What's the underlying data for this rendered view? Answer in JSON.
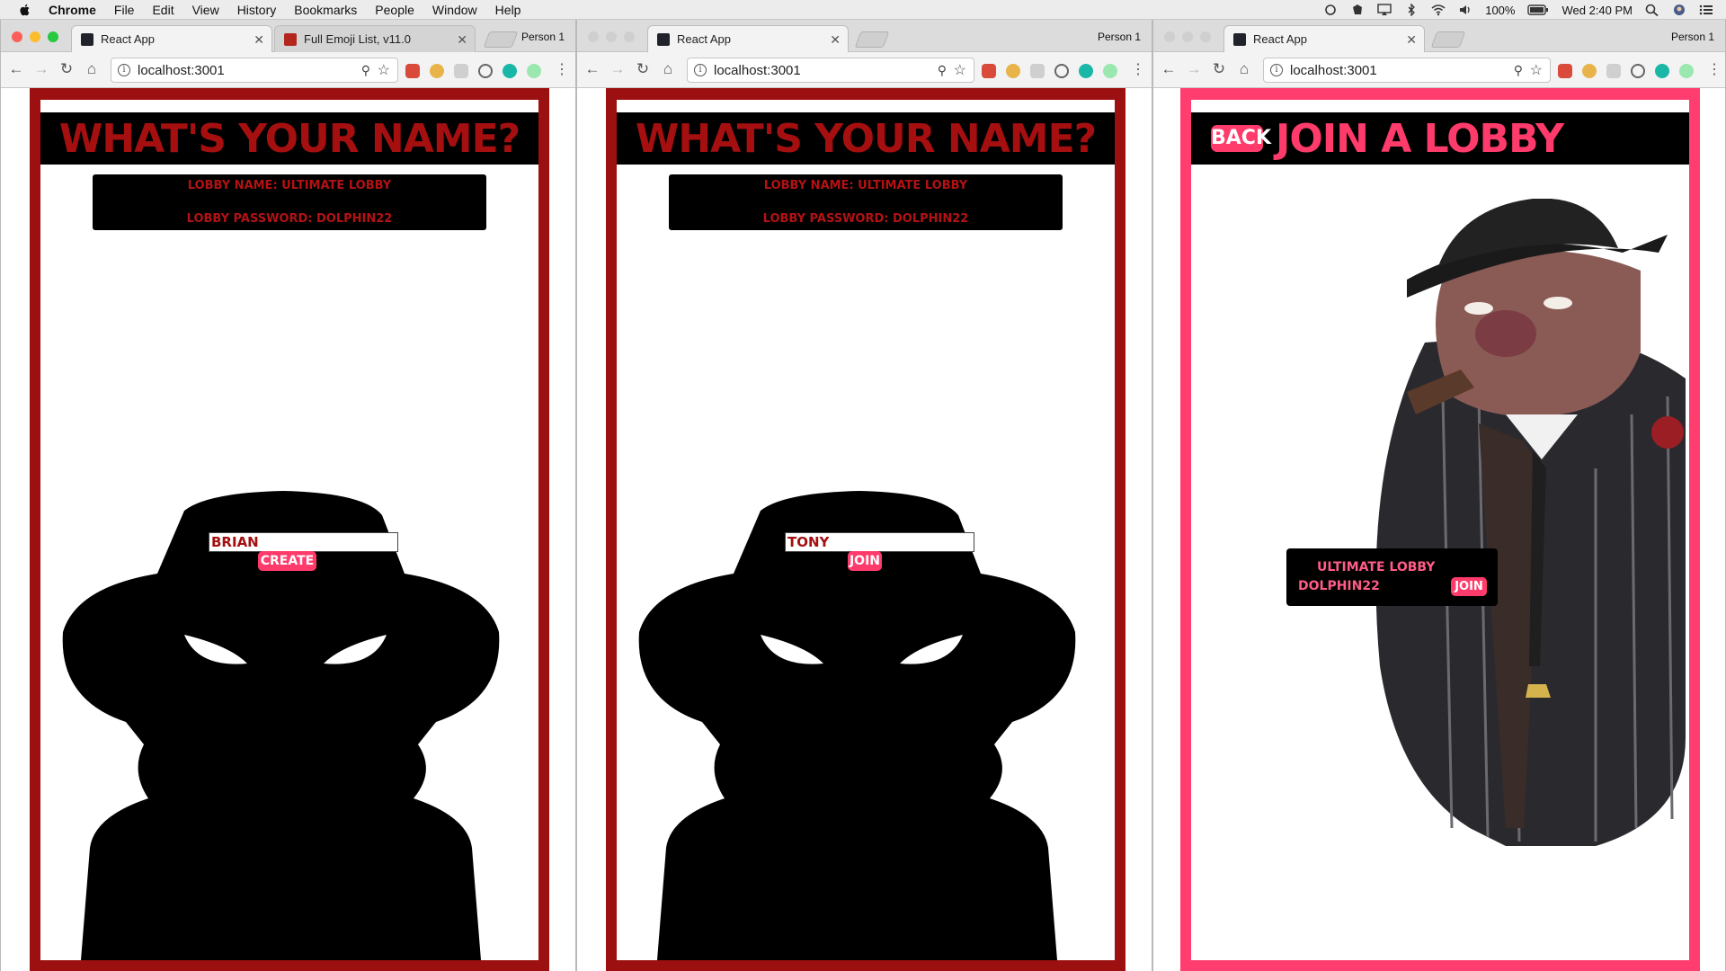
{
  "menubar": {
    "app": "Chrome",
    "items": [
      "File",
      "Edit",
      "View",
      "History",
      "Bookmarks",
      "People",
      "Window",
      "Help"
    ],
    "battery": "100%",
    "clock": "Wed 2:40 PM"
  },
  "windows": [
    {
      "tabs": [
        {
          "title": "React App",
          "active": true
        },
        {
          "title": "Full Emoji List, v11.0",
          "active": false
        }
      ],
      "person": "Person 1",
      "url": "localhost:3001",
      "page": {
        "title": "WHAT'S YOUR NAME?",
        "lobby_name_line": "LOBBY NAME: ULTIMATE LOBBY",
        "lobby_password_line": "LOBBY PASSWORD: DOLPHIN22",
        "name_value": "BRIAN",
        "button_label": "CREATE"
      }
    },
    {
      "tabs": [
        {
          "title": "React App",
          "active": true
        }
      ],
      "person": "Person 1",
      "url": "localhost:3001",
      "page": {
        "title": "WHAT'S YOUR NAME?",
        "lobby_name_line": "LOBBY NAME: ULTIMATE LOBBY",
        "lobby_password_line": "LOBBY PASSWORD: DOLPHIN22",
        "name_value": "TONY",
        "button_label": "JOIN"
      }
    },
    {
      "tabs": [
        {
          "title": "React App",
          "active": true
        }
      ],
      "person": "Person 1",
      "url": "localhost:3001",
      "page": {
        "back_label": "BACK",
        "title": "JOIN A LOBBY",
        "lobby": {
          "name": "ULTIMATE LOBBY",
          "password": "DOLPHIN22",
          "button_label": "JOIN"
        }
      }
    }
  ],
  "colors": {
    "dark_red": "#a50f10",
    "frame_red": "#9c1011",
    "pink": "#ff3b6b",
    "frame_pink": "#ff3d6e"
  }
}
